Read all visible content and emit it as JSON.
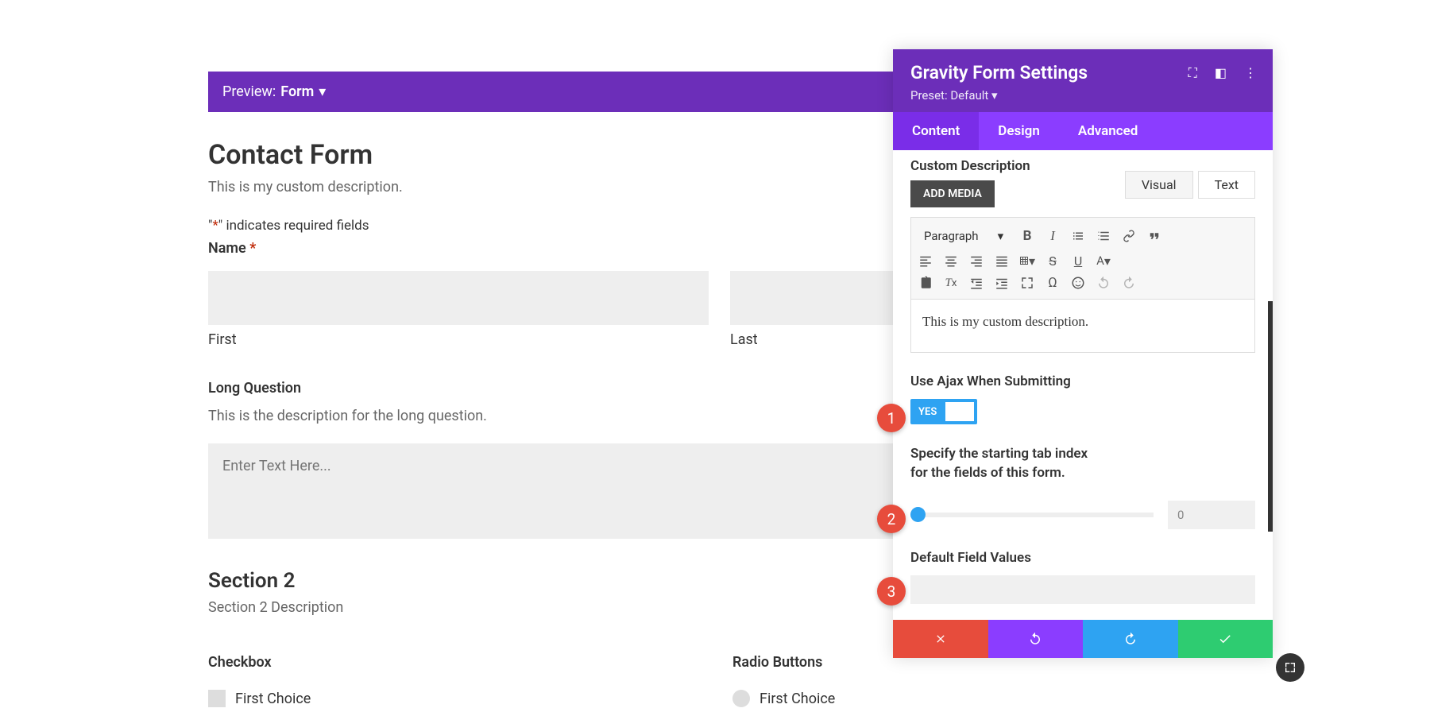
{
  "preview": {
    "label": "Preview:",
    "value": "Form"
  },
  "form": {
    "title": "Contact Form",
    "desc": "This is my custom description.",
    "req_prefix": "\"",
    "req_ast": "*",
    "req_suffix": "\" indicates required fields",
    "name_label": "Name",
    "first": "First",
    "last": "Last",
    "long_q": "Long Question",
    "long_q_desc": "This is the description for the long question.",
    "textarea_ph": "Enter Text Here...",
    "section2_title": "Section 2",
    "section2_desc": "Section 2 Description",
    "checkbox_label": "Checkbox",
    "radio_label": "Radio Buttons",
    "choice1": "First Choice"
  },
  "panel": {
    "title": "Gravity Form Settings",
    "preset": "Preset: Default",
    "tabs": {
      "content": "Content",
      "design": "Design",
      "advanced": "Advanced"
    },
    "cd_label": "Custom Description",
    "add_media": "ADD MEDIA",
    "visual": "Visual",
    "text": "Text",
    "paragraph": "Paragraph",
    "editor_text": "This is my custom description.",
    "ajax_label": "Use Ajax When Submitting",
    "yes": "YES",
    "tab_index_label": "Specify the starting tab index for the fields of this form.",
    "tab_index_val": "0",
    "default_label": "Default Field Values"
  },
  "badges": {
    "b1": "1",
    "b2": "2",
    "b3": "3"
  }
}
